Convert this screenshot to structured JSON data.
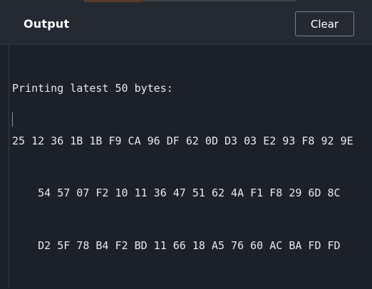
{
  "header": {
    "title": "Output",
    "clear_label": "Clear"
  },
  "console": {
    "lines": [
      "Printing latest 50 bytes:",
      "25 12 36 1B 1B F9 CA 96 DF 62 0D D3 03 E2 93 F8 92 9E",
      "    54 57 07 F2 10 11 36 47 51 62 4A F1 F8 29 6D 8C",
      "    D2 5F 78 B4 F2 BD 11 66 18 A5 76 60 AC BA FD FD"
    ]
  }
}
